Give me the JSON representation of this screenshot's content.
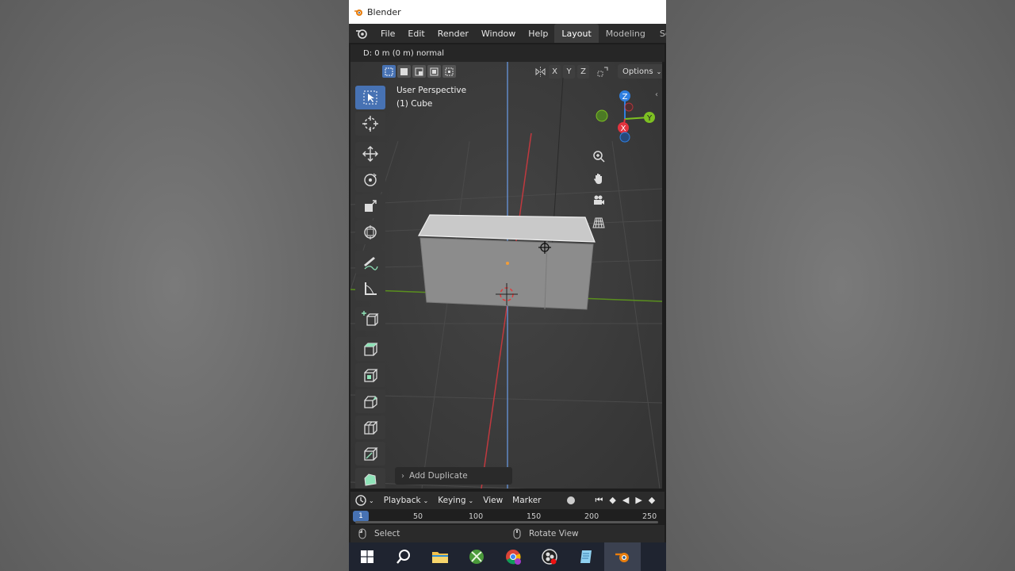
{
  "window": {
    "title": "Blender"
  },
  "menu": {
    "items": [
      "File",
      "Edit",
      "Render",
      "Window",
      "Help"
    ]
  },
  "workspaces": {
    "items": [
      "Layout",
      "Modeling",
      "Sculpting"
    ],
    "active": "Layout"
  },
  "status_top": {
    "text": "D: 0 m (0 m) normal"
  },
  "viewport": {
    "axes": {
      "x": "X",
      "y": "Y",
      "z": "Z"
    },
    "options_label": "Options",
    "overlay_line1": "User Perspective",
    "overlay_line2": "(1) Cube",
    "gizmo": {
      "z": "Z",
      "y": "Y",
      "x": "X"
    },
    "last_op": "Add Duplicate"
  },
  "timeline": {
    "menus": {
      "playback": "Playback",
      "keying": "Keying",
      "view": "View",
      "marker": "Marker"
    },
    "current_frame": "1",
    "ticks": [
      "50",
      "100",
      "150",
      "200",
      "250"
    ]
  },
  "statusbar": {
    "select": "Select",
    "rotate": "Rotate View"
  },
  "colors": {
    "accent": "#4772b3",
    "x_axis": "#e2333f",
    "y_axis": "#7dc022",
    "z_axis": "#2f7fe0",
    "tool_green": "#8fe3b8"
  }
}
